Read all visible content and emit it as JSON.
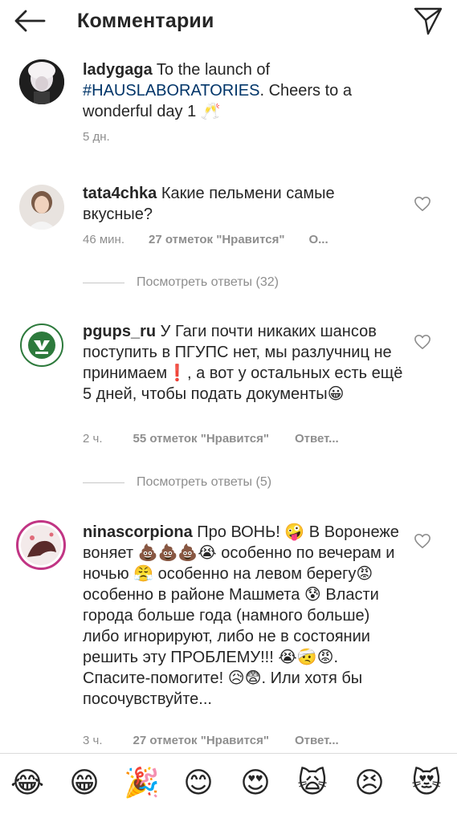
{
  "header": {
    "title": "Комментарии"
  },
  "comments": [
    {
      "username": "ladygaga",
      "text_before": " To the launch of ",
      "hashtag": "#HAUSLABORATORIES",
      "text_after": ". Cheers to a wonderful day 1 🥂",
      "time": "5 дн."
    },
    {
      "username": "tata4chka",
      "text": " Какие пельмени самые вкусные?",
      "time": "46 мин.",
      "likes": "27 отметок \"Нравится\"",
      "reply": "О...",
      "view_replies": "Посмотреть ответы (32)"
    },
    {
      "username": "pgups_ru",
      "text": " У Гаги почти никаких шансов поступить в ПГУПС нет, мы разлучниц не принимаем❗, а вот у остальных есть ещё 5 дней, чтобы подать документы😀",
      "time": "2 ч.",
      "likes": "55 отметок \"Нравится\"",
      "reply": "Ответ...",
      "view_replies": "Посмотреть ответы (5)"
    },
    {
      "username": "ninascorpiona",
      "text": " Про ВОНЬ! 🤪 В Воронеже воняет 💩💩💩😭 особенно по вечерам и ночью 😤 особенно на левом берегу😡 особенно в районе Машмета 😰 Власти города больше года (намного больше) либо игнорируют, либо не в состоянии решить эту ПРОБЛЕМУ!!! 😭🤕😡. Спасите-помогите! 😥😨. Или хотя бы посочувствуйте...",
      "time": "3 ч.",
      "likes": "27 отметок \"Нравится\"",
      "reply": "Ответ..."
    }
  ],
  "emoji_bar": [
    "😂",
    "😁",
    "🎉",
    "😊",
    "😍",
    "🙀",
    "😣",
    "😻"
  ]
}
